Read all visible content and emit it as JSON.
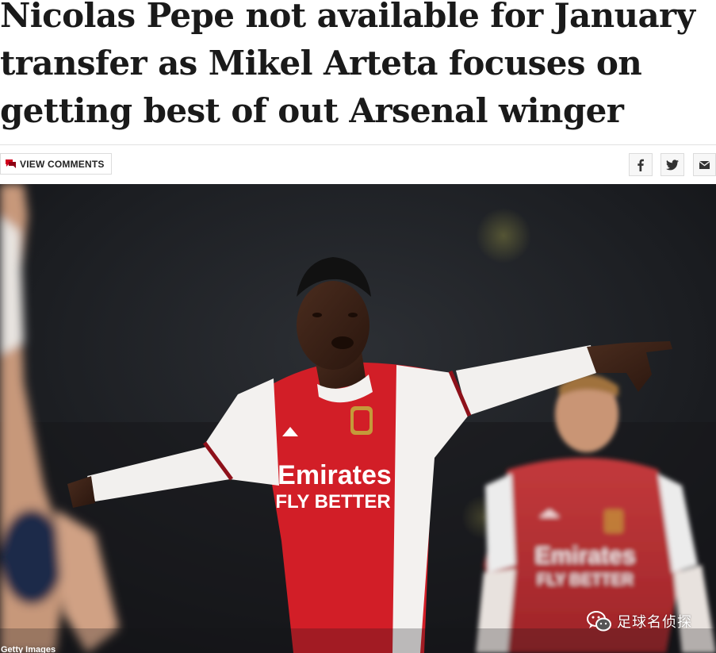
{
  "article": {
    "headline": "Nicolas Pepe not available for January transfer as Mikel Arteta focuses on getting best of out Arsenal winger",
    "comments_label": "VIEW COMMENTS",
    "share": {
      "facebook_icon": "facebook-icon",
      "twitter_icon": "twitter-icon",
      "email_icon": "email-icon"
    }
  },
  "photo": {
    "credit": "Getty Images",
    "watermark_text": "足球名侦探",
    "watermark_icon": "wechat-icon",
    "shirt_sponsor": "Emirates",
    "shirt_tagline": "FLY BETTER"
  },
  "colors": {
    "headline": "#1a1a1a",
    "comment_icon": "#d1001c",
    "arsenal_red": "#d21e27"
  }
}
